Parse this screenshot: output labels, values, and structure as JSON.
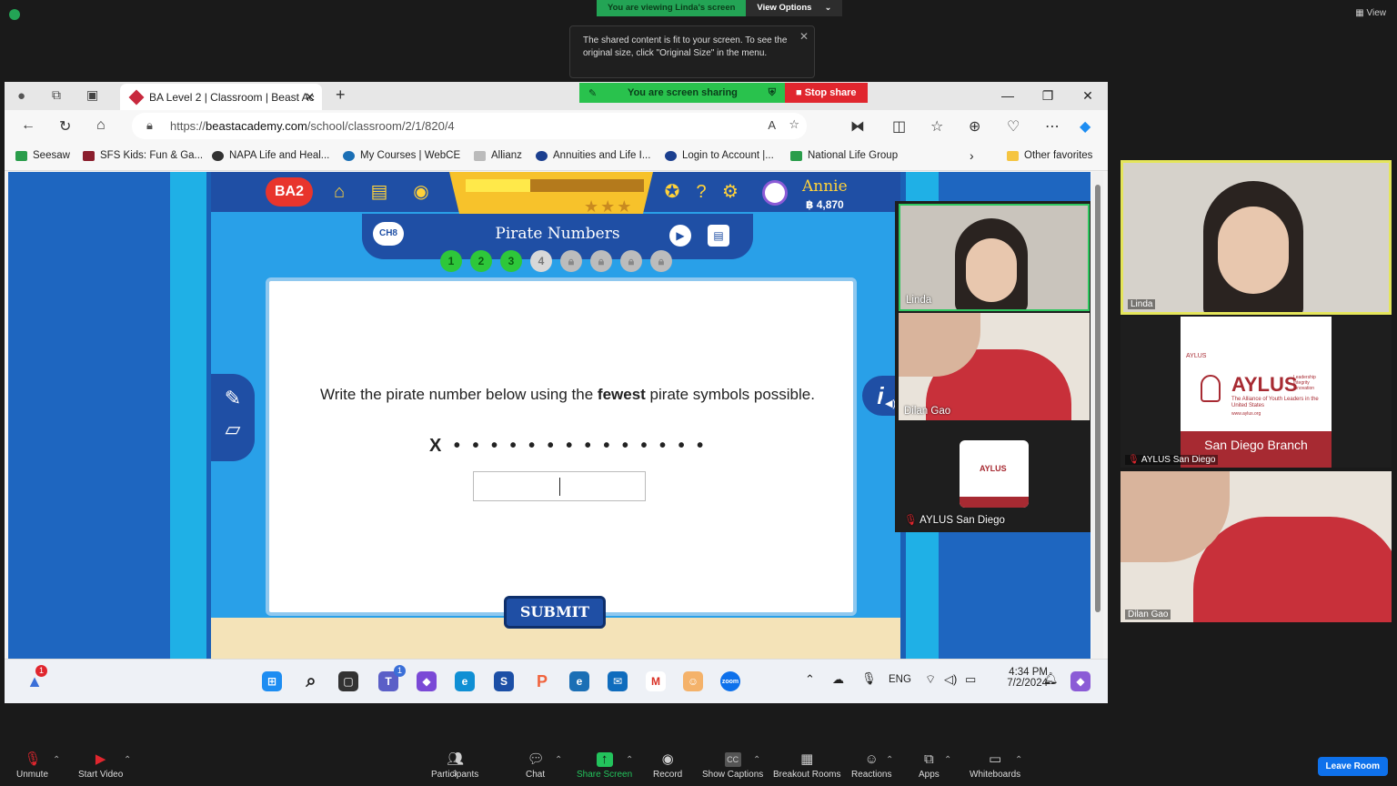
{
  "zoom": {
    "viewing_label": "You are viewing Linda's screen",
    "view_options": "View Options",
    "tooltip": "The shared content is fit to your screen. To see the original size, click \"Original Size\" in the menu.",
    "view_label": "View",
    "leave": "Leave Room",
    "toolbar": [
      {
        "label": "Unmute",
        "icon": "mic-muted-icon"
      },
      {
        "label": "Start Video",
        "icon": "video-off-icon"
      },
      {
        "label": "Participants",
        "icon": "participants-icon",
        "count": "3"
      },
      {
        "label": "Chat",
        "icon": "chat-icon"
      },
      {
        "label": "Share Screen",
        "icon": "share-screen-icon"
      },
      {
        "label": "Record",
        "icon": "record-icon"
      },
      {
        "label": "Show Captions",
        "icon": "captions-icon"
      },
      {
        "label": "Breakout Rooms",
        "icon": "breakout-icon"
      },
      {
        "label": "Reactions",
        "icon": "reactions-icon"
      },
      {
        "label": "Apps",
        "icon": "apps-icon"
      },
      {
        "label": "Whiteboards",
        "icon": "whiteboard-icon"
      }
    ],
    "gallery": [
      {
        "name": "Linda"
      },
      {
        "name": "AYLUS San Diego"
      },
      {
        "name": "Dilan Gao"
      }
    ]
  },
  "browser": {
    "tab_title": "BA Level 2 | Classroom | Beast Ac",
    "sharing_label": "You are screen sharing",
    "stop_share": "Stop share",
    "url_prefix": "https://",
    "url_domain": "beastacademy.com",
    "url_path": "/school/classroom/2/1/820/4",
    "bookmarks": [
      "Seesaw",
      "SFS Kids: Fun & Ga...",
      "NAPA Life and Heal...",
      "My Courses | WebCE",
      "Allianz",
      "Annuities and Life I...",
      "Login to Account |...",
      "National Life Group"
    ],
    "other_favorites": "Other favorites"
  },
  "game": {
    "logo": "BA2",
    "user_name": "Annie",
    "coins": "4,870",
    "progress": 0.36,
    "chapter": "CH8",
    "title": "Pirate Numbers",
    "levels": [
      "1",
      "2",
      "3",
      "4"
    ],
    "question_before": "Write the pirate number below using the ",
    "question_bold": "fewest",
    "question_after": " pirate symbols possible.",
    "pirate_number": "X • • • • • • • • • • • • • •",
    "submit": "SUBMIT"
  },
  "overlay_videos": [
    {
      "name": "Linda"
    },
    {
      "name": "Dilan Gao"
    },
    {
      "name": "AYLUS San Diego"
    }
  ],
  "aylus": {
    "brand_small": "AYLUS",
    "brand": "AYLUS",
    "tagline": "Leadership Integrity Innovation",
    "subtitle": "The Alliance of Youth Leaders in the United States",
    "web": "www.aylus.org",
    "branch": "San Diego Branch"
  },
  "taskbar": {
    "time": "4:34 PM",
    "date": "7/2/2024",
    "lang": "ENG",
    "notif_badge": "1",
    "teams_badge": "1"
  }
}
